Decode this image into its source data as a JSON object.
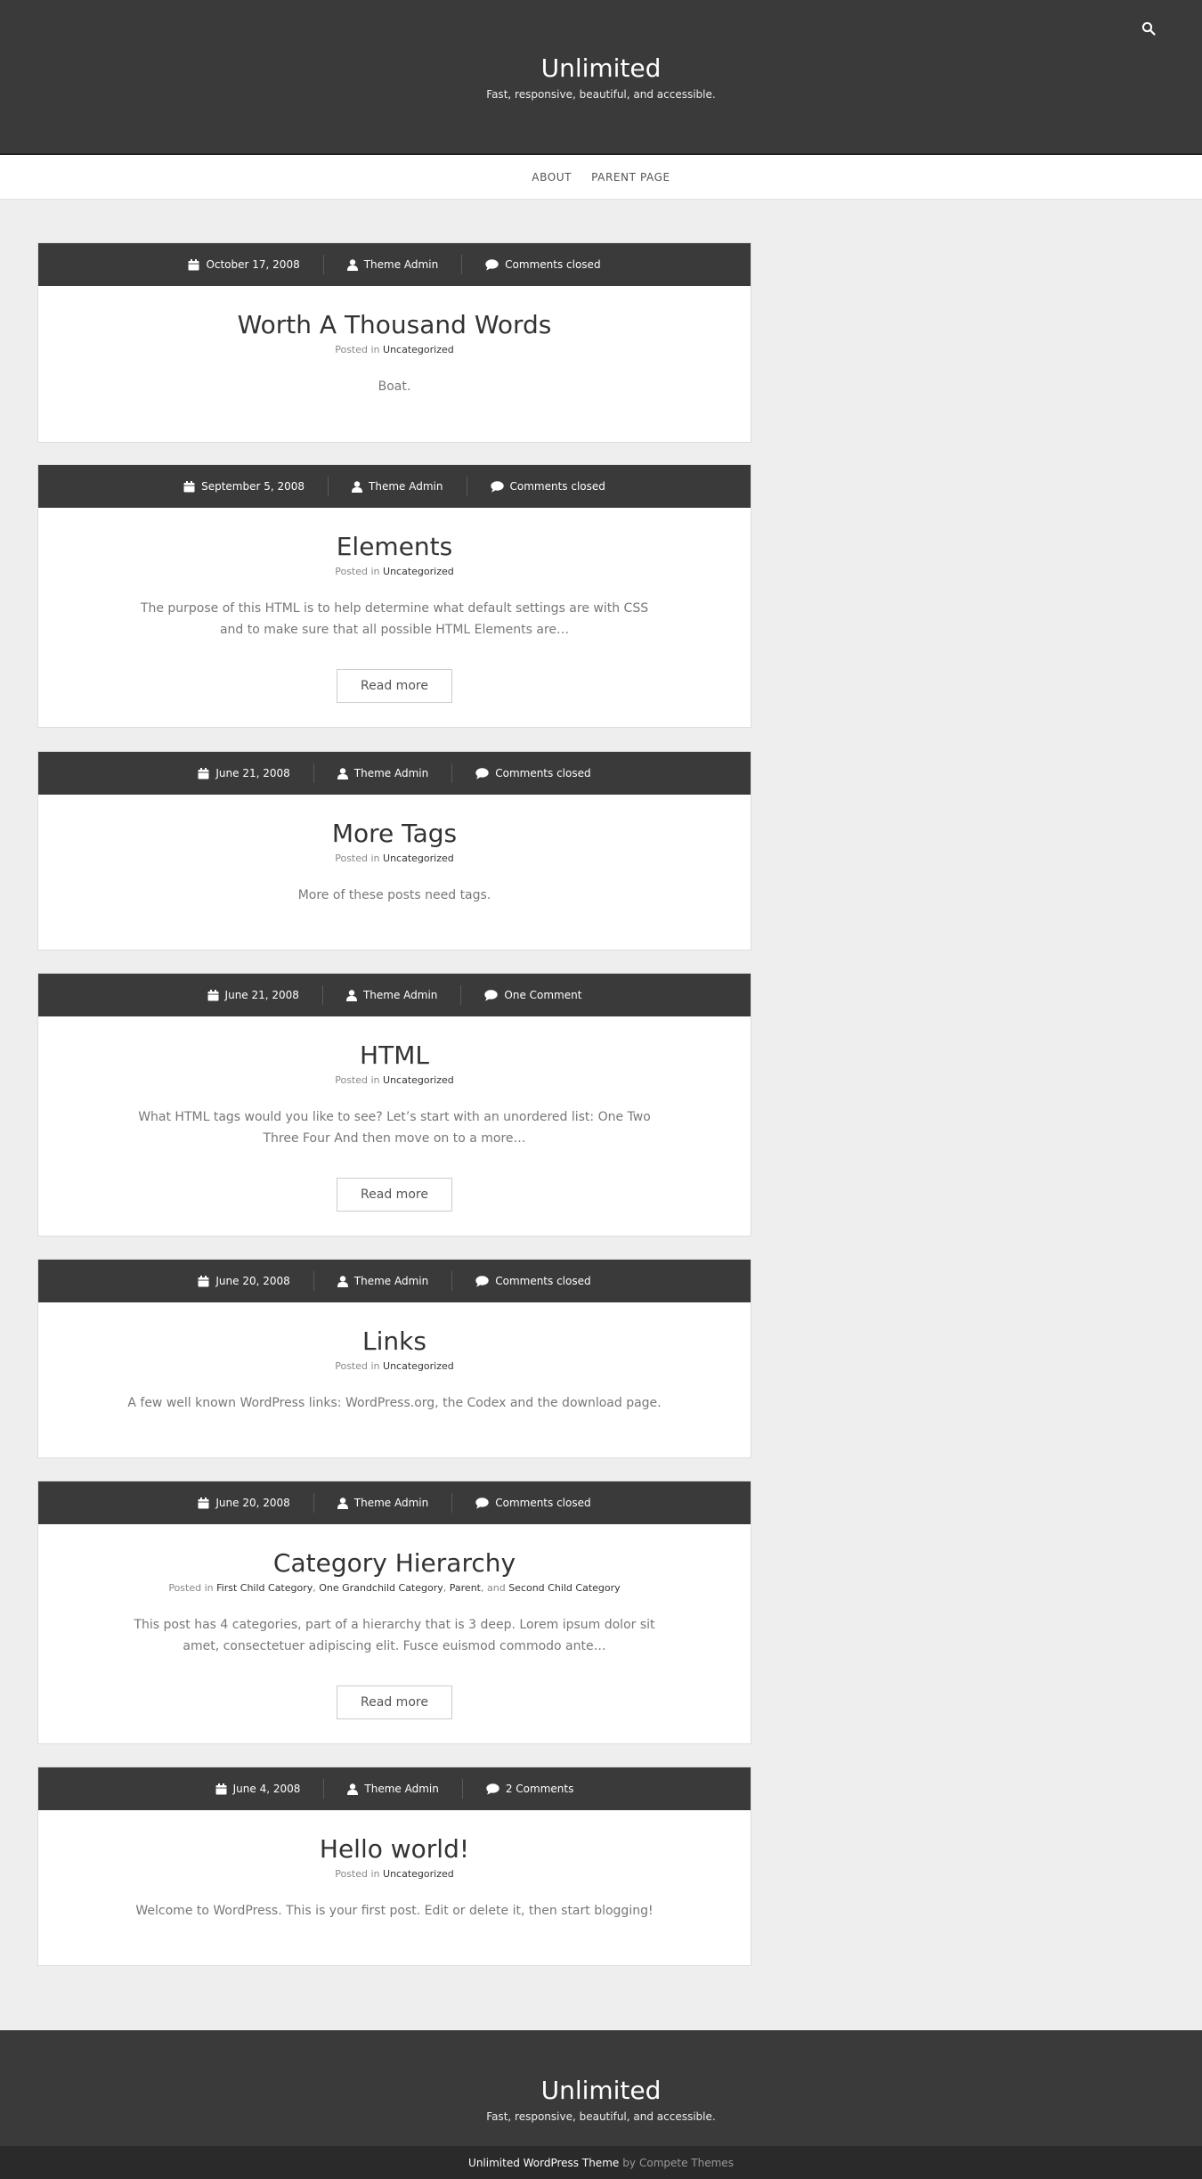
{
  "header": {
    "site_title": "Unlimited",
    "tagline": "Fast, responsive, beautiful, and accessible.",
    "search_icon": "search-icon"
  },
  "nav": {
    "items": [
      {
        "label": "About"
      },
      {
        "label": "Parent Page"
      }
    ]
  },
  "posts": [
    {
      "date": "October 17, 2008",
      "author": "Theme Admin",
      "comments": "Comments closed",
      "title": "Worth A Thousand Words",
      "posted_in": "Posted in",
      "categories": [
        "Uncategorized"
      ],
      "excerpt": "Boat."
    },
    {
      "date": "September 5, 2008",
      "author": "Theme Admin",
      "comments": "Comments closed",
      "title": "Elements",
      "posted_in": "Posted in",
      "categories": [
        "Uncategorized"
      ],
      "excerpt": "The purpose of this HTML is to help determine what default settings are with CSS and to make sure that all possible HTML Elements are…",
      "read_more": "Read more"
    },
    {
      "date": "June 21, 2008",
      "author": "Theme Admin",
      "comments": "Comments closed",
      "title": "More Tags",
      "posted_in": "Posted in",
      "categories": [
        "Uncategorized"
      ],
      "excerpt": "More of these posts need tags."
    },
    {
      "date": "June 21, 2008",
      "author": "Theme Admin",
      "comments": "One Comment",
      "title": "HTML",
      "posted_in": "Posted in",
      "categories": [
        "Uncategorized"
      ],
      "excerpt": "What HTML tags would you like to see? Let’s start with an unordered list: One Two Three Four And then move on to a more…",
      "read_more": "Read more"
    },
    {
      "date": "June 20, 2008",
      "author": "Theme Admin",
      "comments": "Comments closed",
      "title": "Links",
      "posted_in": "Posted in",
      "categories": [
        "Uncategorized"
      ],
      "excerpt": "A few well known WordPress links: WordPress.org, the Codex and the download page."
    },
    {
      "date": "June 20, 2008",
      "author": "Theme Admin",
      "comments": "Comments closed",
      "title": "Category Hierarchy",
      "posted_in": "Posted in",
      "categories": [
        "First Child Category",
        "One Grandchild Category",
        "Parent",
        "Second Child Category"
      ],
      "cat_separator": ",",
      "cat_and": "and",
      "excerpt": "This post has 4 categories, part of a hierarchy that is 3 deep. Lorem ipsum dolor sit amet, consectetuer adipiscing elit. Fusce euismod commodo ante…",
      "read_more": "Read more"
    },
    {
      "date": "June 4, 2008",
      "author": "Theme Admin",
      "comments": "2 Comments",
      "title": "Hello world!",
      "posted_in": "Posted in",
      "categories": [
        "Uncategorized"
      ],
      "excerpt": "Welcome to WordPress. This is your first post. Edit or delete it, then start blogging!"
    }
  ],
  "footer": {
    "site_title": "Unlimited",
    "tagline": "Fast, responsive, beautiful, and accessible.",
    "credit_link": "Unlimited WordPress Theme",
    "credit_by": "by",
    "credit_author": "Compete Themes"
  }
}
